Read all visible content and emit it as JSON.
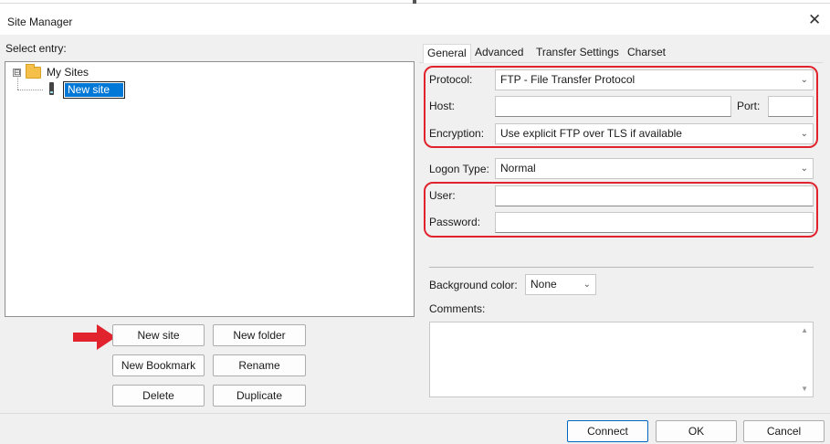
{
  "window": {
    "title": "Site Manager",
    "close_glyph": "✕"
  },
  "left": {
    "select_label": "Select entry:",
    "tree": {
      "expander": "⊟",
      "root_label": "My Sites",
      "child_label": "New site"
    },
    "buttons": {
      "new_site": "New site",
      "new_folder": "New folder",
      "new_bookmark": "New Bookmark",
      "rename": "Rename",
      "delete": "Delete",
      "duplicate": "Duplicate"
    }
  },
  "tabs": [
    {
      "label": "General",
      "active": true
    },
    {
      "label": "Advanced",
      "active": false
    },
    {
      "label": "Transfer Settings",
      "active": false
    },
    {
      "label": "Charset",
      "active": false
    }
  ],
  "general": {
    "protocol_label": "Protocol:",
    "protocol_value": "FTP - File Transfer Protocol",
    "host_label": "Host:",
    "host_value": "",
    "port_label": "Port:",
    "port_value": "",
    "encryption_label": "Encryption:",
    "encryption_value": "Use explicit FTP over TLS if available",
    "logon_type_label": "Logon Type:",
    "logon_type_value": "Normal",
    "user_label": "User:",
    "user_value": "",
    "password_label": "Password:",
    "password_value": "",
    "bg_color_label": "Background color:",
    "bg_color_value": "None",
    "comments_label": "Comments:",
    "comments_value": ""
  },
  "footer": {
    "connect": "Connect",
    "ok": "OK",
    "cancel": "Cancel"
  },
  "icons": {
    "dropdown": "chevron-down-icon",
    "folder": "folder-icon",
    "server": "server-icon",
    "annotation_arrow": "red-arrow-icon"
  },
  "colors": {
    "highlight_red": "#e1232e",
    "selection_blue": "#0078d7",
    "folder_yellow": "#f5c04a"
  }
}
